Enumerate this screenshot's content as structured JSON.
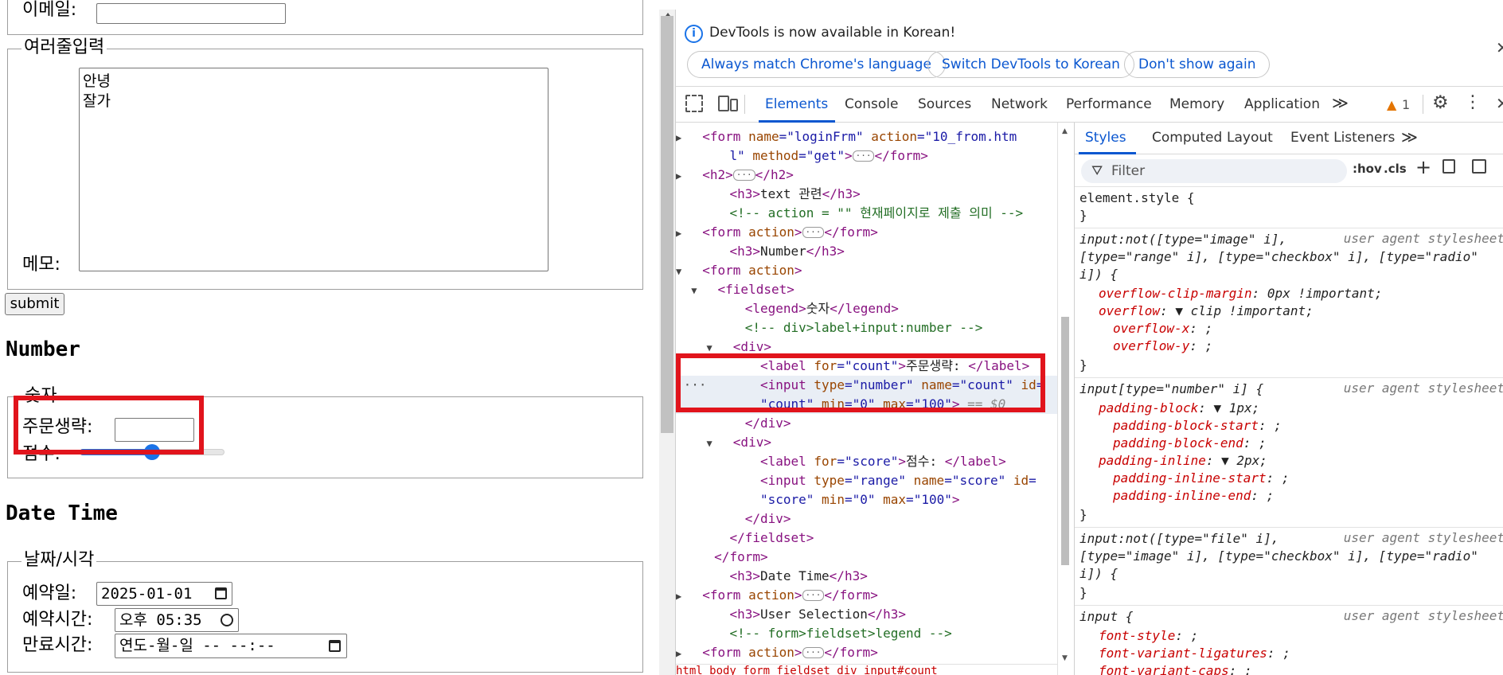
{
  "page": {
    "email_label": "이메일:",
    "multiline_legend": "여러줄입력",
    "memo_label": "메모:",
    "memo_text": "안녕\n잘가",
    "submit_label": "submit",
    "number_heading": "Number",
    "number_legend": "숫자",
    "count_label": "주문생략:",
    "score_label": "점수:",
    "score_value": 50,
    "datetime_heading": "Date Time",
    "datetime_legend": "날짜/시각",
    "date_label": "예약일:",
    "date_value": "2025-01-01",
    "time_label": "예약시간:",
    "time_value": "오후 05:35",
    "expire_label": "만료시간:",
    "expire_value": "연도-월-일 -- --:--"
  },
  "devtools": {
    "info_text": "DevTools is now available in Korean!",
    "btn_match": "Always match Chrome's language",
    "btn_switch": "Switch DevTools to Korean",
    "btn_dont": "Don't show again",
    "tabs": [
      "Elements",
      "Console",
      "Sources",
      "Network",
      "Performance",
      "Memory",
      "Application"
    ],
    "more": "≫",
    "warn_count": "1",
    "style_tabs": [
      "Styles",
      "Computed",
      "Layout",
      "Event Listeners"
    ],
    "filter_placeholder": "Filter",
    "hov": ":hov",
    "cls": ".cls",
    "breadcrumb": "html body form fieldset div input#count"
  },
  "colors": {
    "accent": "#0b57d0",
    "highlight": "#e1141c",
    "warning": "#e37400"
  }
}
